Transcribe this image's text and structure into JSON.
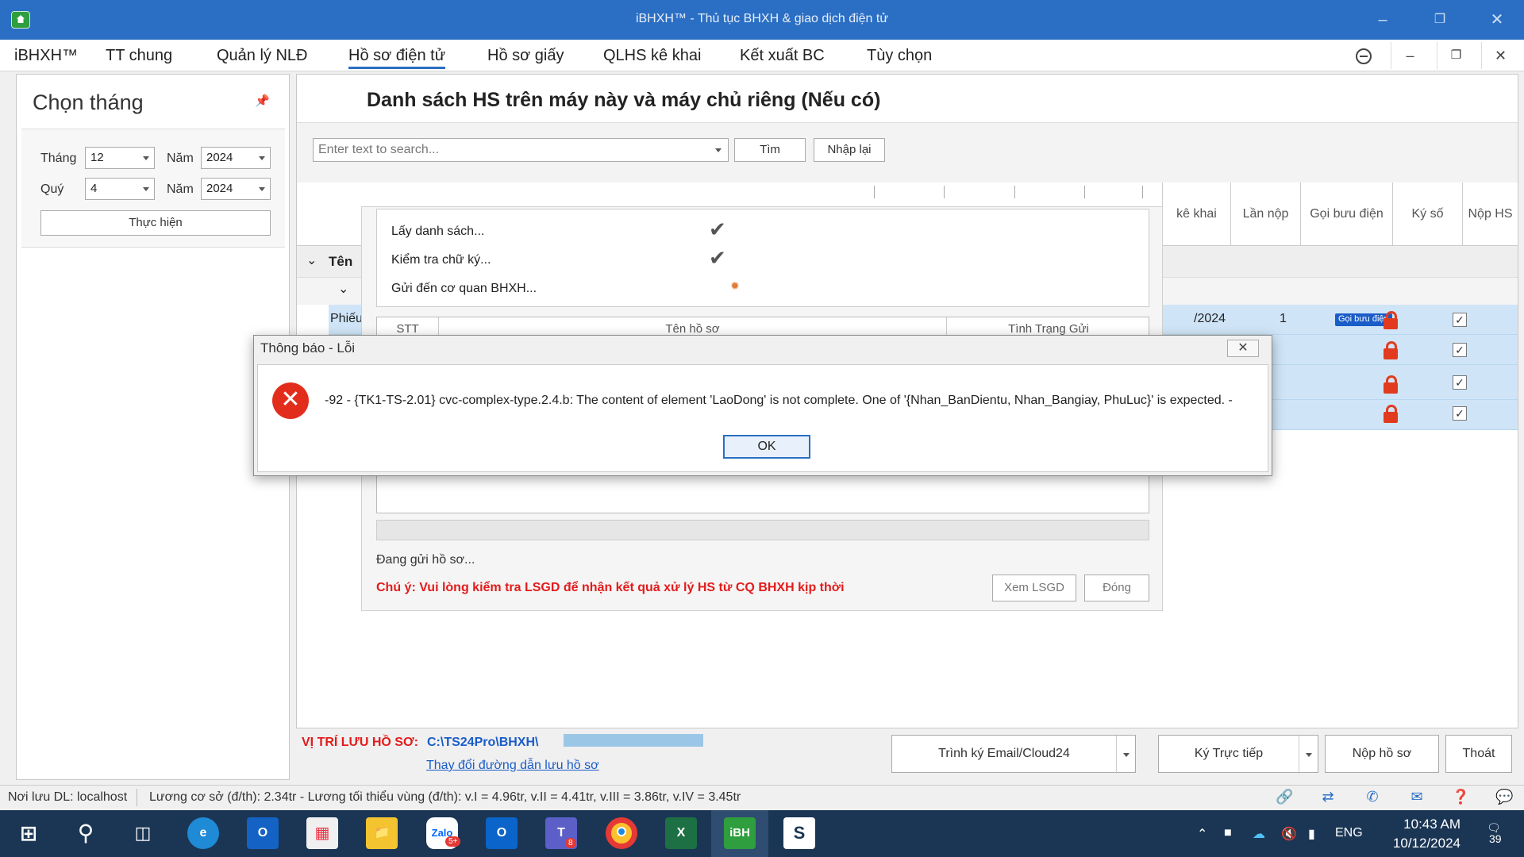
{
  "window": {
    "title": "iBHXH™ - Thủ tục BHXH & giao dịch điện tử"
  },
  "menu": {
    "items": [
      "iBHXH™",
      "TT chung",
      "Quản lý NLĐ",
      "Hồ sơ điện tử",
      "Hồ sơ giấy",
      "QLHS kê khai",
      "Kết xuất BC",
      "Tùy chọn"
    ],
    "active": "Hồ sơ điện tử"
  },
  "left_panel": {
    "title": "Chọn tháng",
    "month_label": "Tháng",
    "month_value": "12",
    "year_label": "Năm",
    "year_value": "2024",
    "quarter_label": "Quý",
    "quarter_value": "4",
    "year2_label": "Năm",
    "year2_value": "2024",
    "run_button": "Thực hiện"
  },
  "main": {
    "title": "Danh sách HS trên máy này và máy chủ riêng (Nếu có)",
    "search_placeholder": "Enter text to search...",
    "search_button": "Tìm",
    "reset_button": "Nhập lại",
    "columns": [
      "kê khai",
      "Lần nộp",
      "Gọi bưu điện",
      "Ký số",
      "Nộp HS"
    ],
    "group_label": "Tên",
    "row_label": "Phiếu",
    "first_row": {
      "period": "/2024",
      "submit_count": "1",
      "postal_badge": "Gọi bưu điện"
    }
  },
  "progress": {
    "steps": [
      {
        "label": "Lấy danh sách...",
        "status": "done"
      },
      {
        "label": "Kiểm tra chữ ký...",
        "status": "done"
      },
      {
        "label": "Gửi đến cơ quan BHXH...",
        "status": "in-progress"
      }
    ],
    "columns": [
      "STT",
      "Tên hồ sơ",
      "Tình Trạng Gửi"
    ],
    "status_text": "Đang gửi hồ sơ...",
    "warning": "Chú ý: Vui lòng kiểm tra LSGD để nhận kết quả xử lý HS từ CQ BHXH kịp thời",
    "view_button": "Xem LSGD",
    "close_button": "Đóng"
  },
  "dialog": {
    "title": "Thông báo - Lỗi",
    "message": "-92 - {TK1-TS-2.01} cvc-complex-type.2.4.b: The content of element 'LaoDong' is not complete. One of '{Nhan_BanDientu, Nhan_Bangiay, PhuLuc}' is expected. -",
    "ok_button": "OK"
  },
  "bottom": {
    "save_label": "VỊ TRÍ LƯU HỒ SƠ:",
    "save_path": "C:\\TS24Pro\\BHXH\\",
    "change_link": "Thay đổi đường dẫn lưu hồ sơ",
    "sign_email_button": "Trình ký Email/Cloud24",
    "sign_direct_button": "Ký Trực tiếp",
    "submit_button": "Nộp hồ sơ",
    "exit_button": "Thoát"
  },
  "statusbar": {
    "data_location": "Nơi lưu DL: localhost",
    "salary_info": "Lương cơ sở (đ/th): 2.34tr - Lương tối thiểu vùng (đ/th): v.I =  4.96tr, v.II = 4.41tr, v.III = 3.86tr, v.IV = 3.45tr"
  },
  "taskbar": {
    "zalo_badge": "5+",
    "teams_badge": "8",
    "language": "ENG",
    "time": "10:43 AM",
    "date": "10/12/2024",
    "notification_count": "39"
  },
  "colors": {
    "titlebar": "#2b6fc4",
    "error": "#e32d1c",
    "warning_text": "#e31b1b",
    "link": "#1a5cc8",
    "selected_row": "#cfe5f7",
    "taskbar": "#1b3655"
  }
}
